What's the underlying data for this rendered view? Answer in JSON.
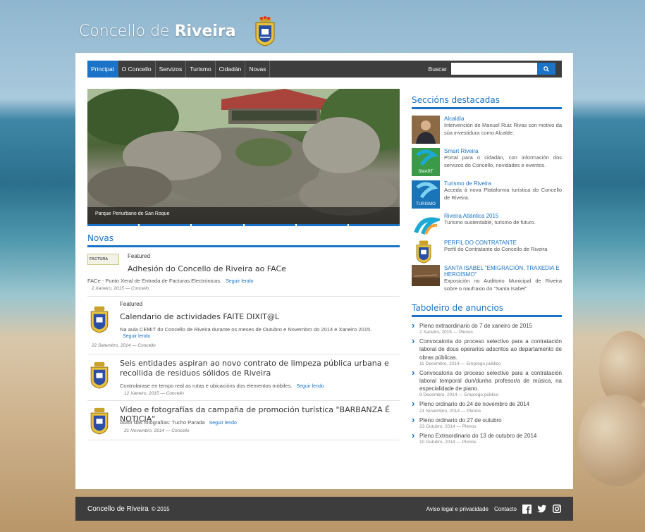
{
  "header": {
    "title_prefix": "Concello de ",
    "title_bold": "Riveira"
  },
  "nav": {
    "items": [
      "Principal",
      "O Concello",
      "Servizos",
      "Turismo",
      "Cidadán",
      "Novas"
    ],
    "active": "Principal",
    "search_label": "Buscar",
    "search_value": ""
  },
  "slider": {
    "caption": "Parque Periurbano de San Roque"
  },
  "novas": {
    "title": "Novas",
    "items": [
      {
        "featured": "Featured",
        "title": "Adhesión do Concello de Riveira ao FACe",
        "excerpt": "FACe - Punto Xeral de Entrada de Facturas Electrónicas.",
        "read_more": "Seguir lendo",
        "meta": "2 Xaneiro, 2015 — Concello",
        "logo_text": "FACTURA"
      },
      {
        "featured": "Featured",
        "title": "Calendario de actividades FAITE DIXIT@L",
        "excerpt": "Na aula CEMIT do Concello de Riveira durante os meses de Outubro e Novembro do 2014 e Xaneiro 2015.",
        "read_more": "Seguir lendo",
        "meta": "22 Setembro, 2014 — Concello"
      },
      {
        "title": "Seis entidades aspiran ao novo contrato de limpeza pública urbana e recollida de residuos sólidos de Riveira",
        "excerpt": "Controlarase en tempo real as rutas e ubicacións dos elementos móbiles.",
        "read_more": "Seguir lendo",
        "meta": "12 Xaneiro, 2015 — Concello"
      },
      {
        "title": "Vídeo e fotografías da campaña de promoción turística \"BARBANZA É NOTICIA\"",
        "excerpt": "Autor das fotografías: Tucho Parada",
        "read_more": "Seguir lendo",
        "meta": "21 Novembro, 2014 — Concello"
      }
    ]
  },
  "seccions": {
    "title": "Seccións destacadas",
    "items": [
      {
        "title": "Alcaldía",
        "desc": "Intervención de Manuel Ruiz Rivas con motivo da súa investidura como Alcalde.",
        "thumb_text": ""
      },
      {
        "title": "Smart Riveira",
        "desc": "Portal para o cidadán, con información dos servizos do Concello, novidades e eventos.",
        "thumb_text": "SMART"
      },
      {
        "title": "Turismo de Riveira",
        "desc": "Acceda á nova Plataforma turística do Concello de Riveira.",
        "thumb_text": "TURISMO"
      },
      {
        "title": "Riveira Atlántica 2015",
        "desc": "Turismo sustentable, turismo de futuro.",
        "thumb_text": ""
      },
      {
        "title": "PERFIL DO CONTRATANTE",
        "desc": "Perfil do Contratante do Concello de Riveira",
        "thumb_text": ""
      },
      {
        "title": "SANTA ISABEL \"EMIGRACIÓN, TRAXEDIA E HEROISMO\"",
        "desc": "Exposición no Auditorio Municipal de Riveira sobre o naufraxio do \"Santa Isabel\"",
        "thumb_text": ""
      }
    ]
  },
  "taboleiro": {
    "title": "Taboleiro de anuncios",
    "items": [
      {
        "title": "Pleno extraordinario do 7 de xaneiro de 2015",
        "meta": "2 Xaneiro, 2015 — Plenos"
      },
      {
        "title": "Convocatoria do proceso selectivo para a contratación laboral de dous operarios adscritos ao departamento de obras públicas.",
        "meta": "11 Decembro, 2014 — Emprego público"
      },
      {
        "title": "Convocatoria do proceso selectivo para a contratación laboral temporal dun/dunha profesor/a de música, na especialidade de piano.",
        "meta": "9 Decembro, 2014 — Emprego público"
      },
      {
        "title": "Pleno ordinario do 24 de novembro de 2014",
        "meta": "21 Novembro, 2014 — Plenos"
      },
      {
        "title": "Pleno ordinario do 27 de outubro",
        "meta": "23 Outubro, 2014 — Plenos"
      },
      {
        "title": "Pleno Extraordinario do 13 de outubro de 2014",
        "meta": "10 Outubro, 2014 — Plenos"
      }
    ]
  },
  "footer": {
    "brand": "Concello de Riveira",
    "year": "© 2015",
    "legal": "Aviso legal e privacidade",
    "contact": "Contacto"
  },
  "colors": {
    "accent": "#1a73c7",
    "dark": "#3d3d3d"
  }
}
